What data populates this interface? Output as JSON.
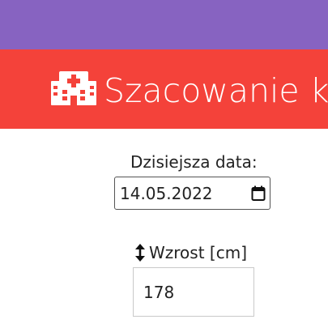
{
  "top_bar": {
    "color": "#8763c1"
  },
  "header": {
    "title": "Szacowanie k",
    "icon": "hospital-icon",
    "color": "#f4423a"
  },
  "form": {
    "date": {
      "label": "Dzisiejsza data:",
      "value": "14.05.2022",
      "icon": "calendar-icon"
    },
    "height": {
      "label": "Wzrost [cm]",
      "value": "178",
      "icon": "vertical-arrows-icon"
    }
  }
}
